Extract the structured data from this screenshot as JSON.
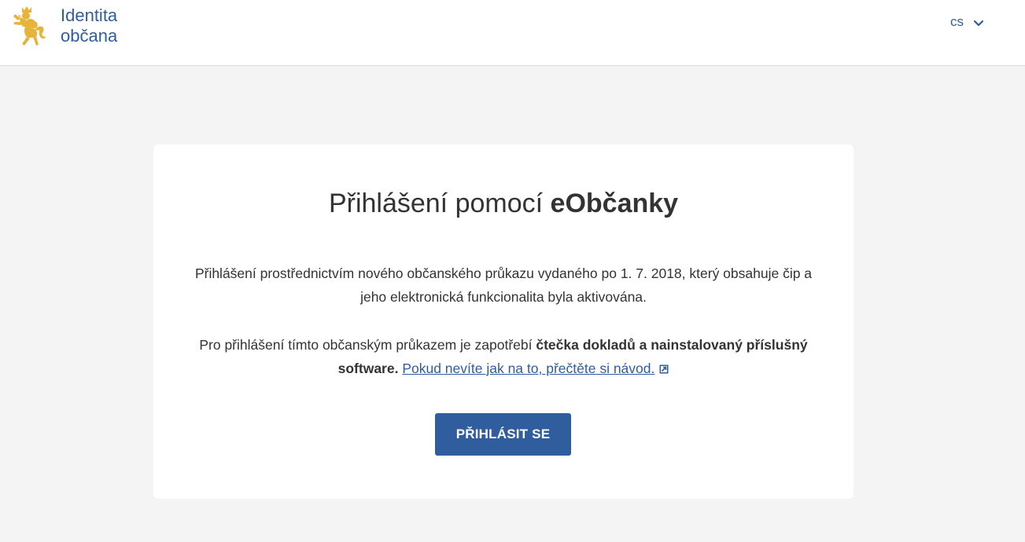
{
  "header": {
    "logo_line1": "Identita",
    "logo_line2": "občana",
    "language": "cs"
  },
  "card": {
    "title_prefix": "Přihlášení pomocí ",
    "title_bold": "eObčanky",
    "paragraph1": "Přihlášení prostřednictvím nového občanského průkazu vydaného po 1. 7. 2018, který obsahuje čip a jeho elektronická funkcionalita byla aktivována.",
    "paragraph2_prefix": "Pro přihlášení tímto občanským průkazem je zapotřebí ",
    "paragraph2_bold": "čtečka dokladů a nainstalovaný příslušný software.",
    "paragraph2_link": "Pokud nevíte jak na to, přečtěte si návod.",
    "login_button": "PŘIHLÁSIT SE"
  },
  "colors": {
    "accent": "#2f5d9e",
    "logo_gold": "#e8b33a",
    "background": "#f4f4f4"
  }
}
